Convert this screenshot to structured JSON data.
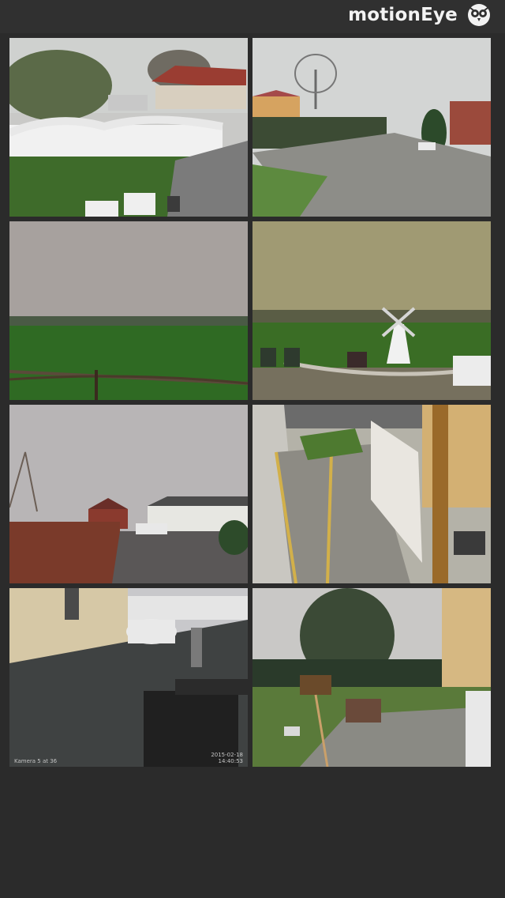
{
  "header": {
    "title": "motionEye",
    "logo_icon": "owl-icon"
  },
  "cameras": [
    {
      "id": "cam-1"
    },
    {
      "id": "cam-2"
    },
    {
      "id": "cam-3"
    },
    {
      "id": "cam-4"
    },
    {
      "id": "cam-5"
    },
    {
      "id": "cam-6"
    },
    {
      "id": "cam-7",
      "label": "Kamera 5 at 36",
      "date": "2015-02-18",
      "time": "14:40:53"
    },
    {
      "id": "cam-8"
    }
  ],
  "colors": {
    "header_bg": "#303030",
    "page_bg": "#2b2b2b",
    "title_text": "#f3f3f3"
  }
}
